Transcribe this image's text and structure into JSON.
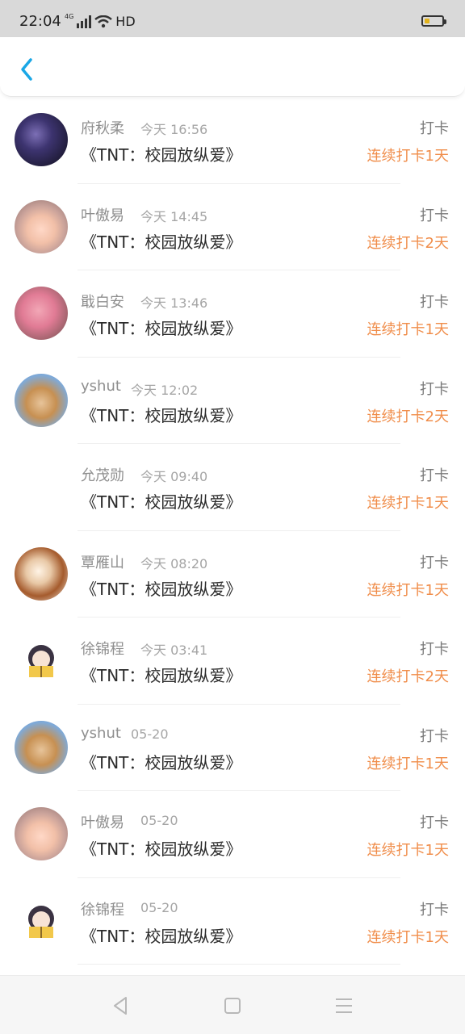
{
  "status_bar": {
    "time": "22:04",
    "network": "4G",
    "hd": "HD"
  },
  "header": {
    "back_icon": "chevron-left-icon",
    "accent": "#1aa7e6"
  },
  "list": [
    {
      "name": "府秋柔",
      "time": "今天 16:56",
      "title": "《TNT：校园放纵爱》",
      "type": "打卡",
      "streak": "连续打卡1天"
    },
    {
      "name": "叶傲易",
      "time": "今天 14:45",
      "title": "《TNT：校园放纵爱》",
      "type": "打卡",
      "streak": "连续打卡2天"
    },
    {
      "name": "戢白安",
      "time": "今天 13:46",
      "title": "《TNT：校园放纵爱》",
      "type": "打卡",
      "streak": "连续打卡1天"
    },
    {
      "name": "yshut",
      "time": "今天 12:02",
      "title": "《TNT：校园放纵爱》",
      "type": "打卡",
      "streak": "连续打卡2天"
    },
    {
      "name": "允茂勋",
      "time": "今天 09:40",
      "title": "《TNT：校园放纵爱》",
      "type": "打卡",
      "streak": "连续打卡1天"
    },
    {
      "name": "覃雁山",
      "time": "今天 08:20",
      "title": "《TNT：校园放纵爱》",
      "type": "打卡",
      "streak": "连续打卡1天"
    },
    {
      "name": "徐锦程",
      "time": "今天 03:41",
      "title": "《TNT：校园放纵爱》",
      "type": "打卡",
      "streak": "连续打卡2天"
    },
    {
      "name": "yshut",
      "time": "05-20",
      "title": "《TNT：校园放纵爱》",
      "type": "打卡",
      "streak": "连续打卡1天"
    },
    {
      "name": "叶傲易",
      "time": "05-20",
      "title": "《TNT：校园放纵爱》",
      "type": "打卡",
      "streak": "连续打卡1天"
    },
    {
      "name": "徐锦程",
      "time": "05-20",
      "title": "《TNT：校园放纵爱》",
      "type": "打卡",
      "streak": "连续打卡1天"
    }
  ],
  "nav": {
    "back_icon": "triangle-back-icon",
    "home_icon": "square-home-icon",
    "menu_icon": "menu-lines-icon"
  },
  "colors": {
    "streak": "#f08d4a",
    "name": "#8f8f8f",
    "title": "#2b2b2b"
  }
}
